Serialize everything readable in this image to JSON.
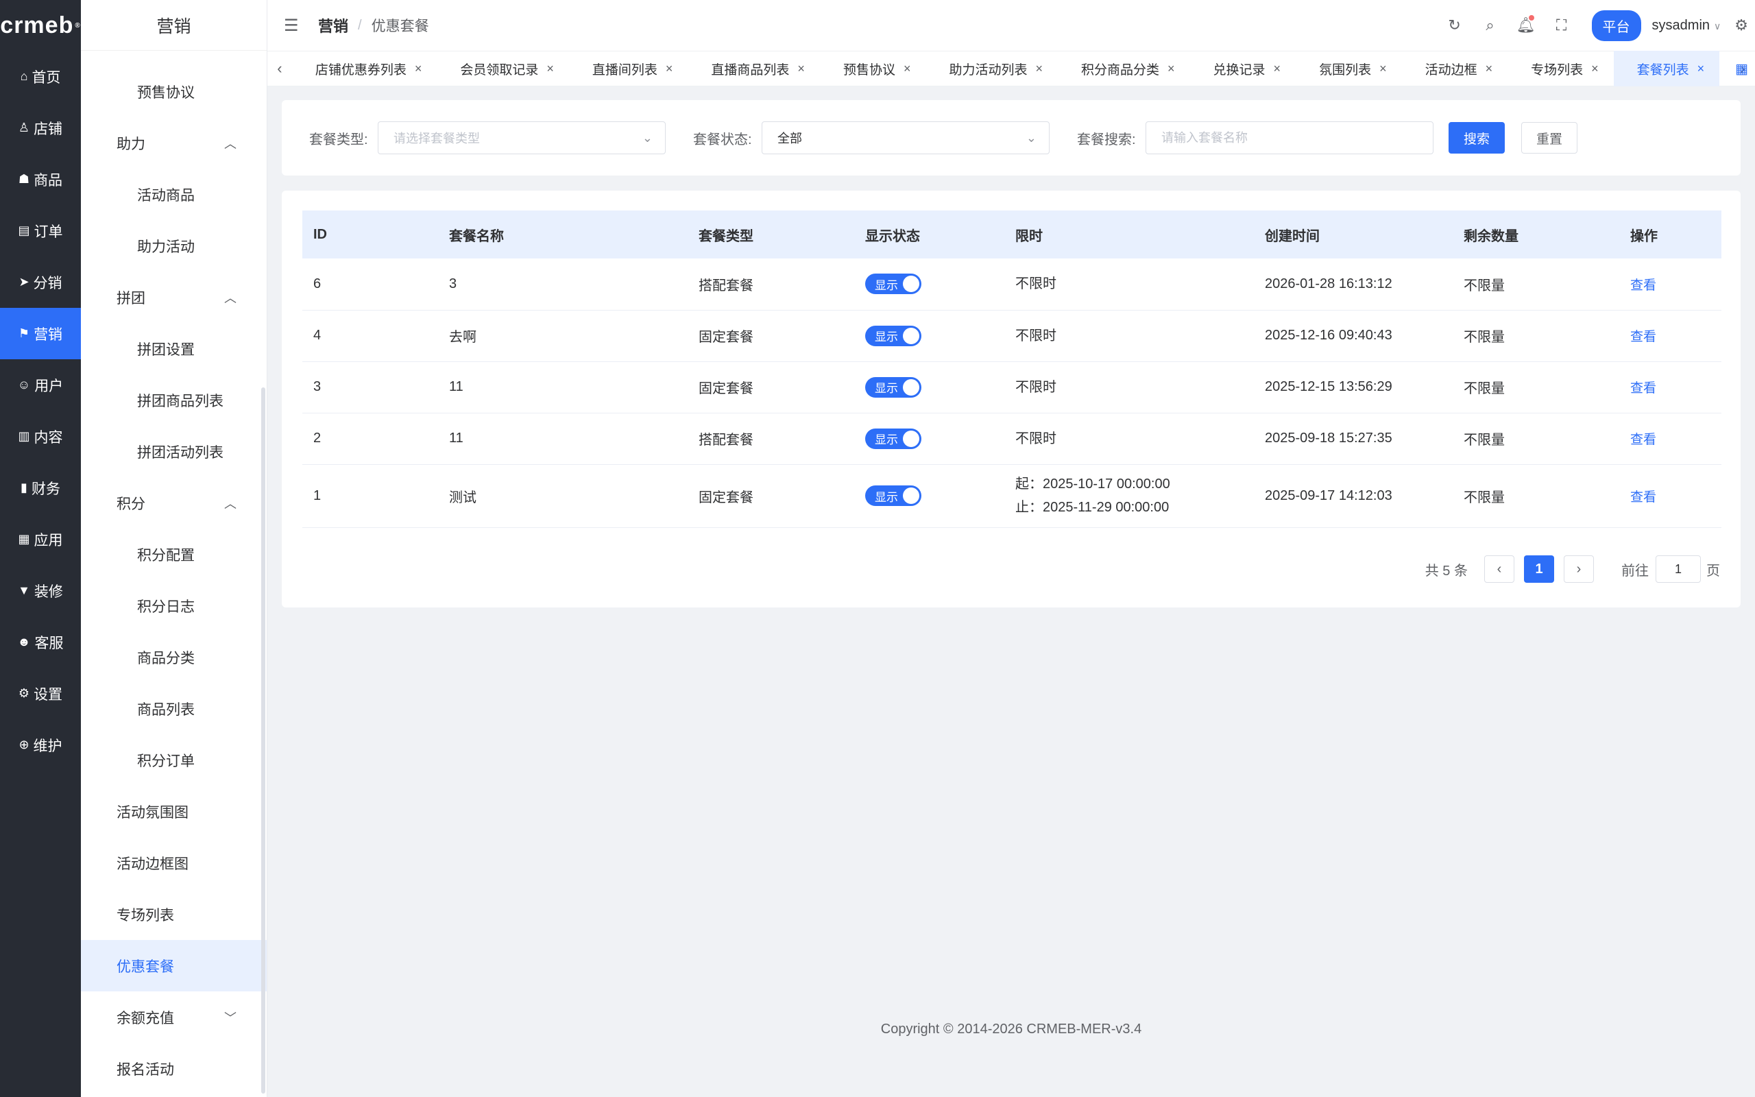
{
  "rail": {
    "logo": "crmeb",
    "logo_mark": "®",
    "items": [
      {
        "label": "首页",
        "icon": "home-icon",
        "glyph": "⌂",
        "active": false
      },
      {
        "label": "店铺",
        "icon": "store-icon",
        "glyph": "♙",
        "active": false
      },
      {
        "label": "商品",
        "icon": "bag-icon",
        "glyph": "☗",
        "active": false
      },
      {
        "label": "订单",
        "icon": "order-icon",
        "glyph": "▤",
        "active": false
      },
      {
        "label": "分销",
        "icon": "send-icon",
        "glyph": "➤",
        "active": false
      },
      {
        "label": "营销",
        "icon": "flag-icon",
        "glyph": "⚑",
        "active": true
      },
      {
        "label": "用户",
        "icon": "user-icon",
        "glyph": "☺",
        "active": false
      },
      {
        "label": "内容",
        "icon": "content-icon",
        "glyph": "▥",
        "active": false
      },
      {
        "label": "财务",
        "icon": "finance-icon",
        "glyph": "▮",
        "active": false
      },
      {
        "label": "应用",
        "icon": "apps-icon",
        "glyph": "▦",
        "active": false
      },
      {
        "label": "装修",
        "icon": "decor-icon",
        "glyph": "▼",
        "active": false
      },
      {
        "label": "客服",
        "icon": "service-icon",
        "glyph": "☻",
        "active": false
      },
      {
        "label": "设置",
        "icon": "gear-icon",
        "glyph": "⚙",
        "active": false
      },
      {
        "label": "维护",
        "icon": "maintain-icon",
        "glyph": "⊕",
        "active": false
      }
    ]
  },
  "sidebar": {
    "title": "营销",
    "items": [
      {
        "label": "预售协议",
        "level": 2
      },
      {
        "label": "助力",
        "level": 1,
        "chevron": "up"
      },
      {
        "label": "活动商品",
        "level": 2
      },
      {
        "label": "助力活动",
        "level": 2
      },
      {
        "label": "拼团",
        "level": 1,
        "chevron": "up"
      },
      {
        "label": "拼团设置",
        "level": 2
      },
      {
        "label": "拼团商品列表",
        "level": 2
      },
      {
        "label": "拼团活动列表",
        "level": 2
      },
      {
        "label": "积分",
        "level": 1,
        "chevron": "up"
      },
      {
        "label": "积分配置",
        "level": 2
      },
      {
        "label": "积分日志",
        "level": 2
      },
      {
        "label": "商品分类",
        "level": 2
      },
      {
        "label": "商品列表",
        "level": 2
      },
      {
        "label": "积分订单",
        "level": 2
      },
      {
        "label": "活动氛围图",
        "level": 1
      },
      {
        "label": "活动边框图",
        "level": 1
      },
      {
        "label": "专场列表",
        "level": 1
      },
      {
        "label": "优惠套餐",
        "level": 1,
        "active": true
      },
      {
        "label": "余额充值",
        "level": 1,
        "chevron": "down"
      },
      {
        "label": "报名活动",
        "level": 1
      }
    ]
  },
  "header": {
    "crumb_main": "营销",
    "crumb_sep": "/",
    "crumb_sub": "优惠套餐",
    "platform": "平台",
    "user": "sysadmin"
  },
  "tabs": [
    {
      "label": "店铺优惠券列表"
    },
    {
      "label": "会员领取记录"
    },
    {
      "label": "直播间列表"
    },
    {
      "label": "直播商品列表"
    },
    {
      "label": "预售协议"
    },
    {
      "label": "助力活动列表"
    },
    {
      "label": "积分商品分类"
    },
    {
      "label": "兑换记录"
    },
    {
      "label": "氛围列表"
    },
    {
      "label": "活动边框"
    },
    {
      "label": "专场列表"
    },
    {
      "label": "套餐列表",
      "active": true
    }
  ],
  "filters": {
    "type_label": "套餐类型:",
    "type_placeholder": "请选择套餐类型",
    "status_label": "套餐状态:",
    "status_value": "全部",
    "search_label": "套餐搜索:",
    "search_placeholder": "请输入套餐名称",
    "search_btn": "搜索",
    "reset_btn": "重置"
  },
  "table": {
    "headers": [
      "ID",
      "套餐名称",
      "套餐类型",
      "显示状态",
      "限时",
      "创建时间",
      "剩余数量",
      "操作"
    ],
    "rows": [
      {
        "id": "6",
        "name": "3",
        "type": "搭配套餐",
        "status": "显示",
        "limit1": "不限时",
        "limit2": "",
        "created": "2026-01-28 16:13:12",
        "remain": "不限量",
        "action": "查看"
      },
      {
        "id": "4",
        "name": "去啊",
        "type": "固定套餐",
        "status": "显示",
        "limit1": "不限时",
        "limit2": "",
        "created": "2025-12-16 09:40:43",
        "remain": "不限量",
        "action": "查看"
      },
      {
        "id": "3",
        "name": "11",
        "type": "固定套餐",
        "status": "显示",
        "limit1": "不限时",
        "limit2": "",
        "created": "2025-12-15 13:56:29",
        "remain": "不限量",
        "action": "查看"
      },
      {
        "id": "2",
        "name": "11",
        "type": "搭配套餐",
        "status": "显示",
        "limit1": "不限时",
        "limit2": "",
        "created": "2025-09-18 15:27:35",
        "remain": "不限量",
        "action": "查看"
      },
      {
        "id": "1",
        "name": "测试",
        "type": "固定套餐",
        "status": "显示",
        "limit1": "起：2025-10-17 00:00:00",
        "limit2": "止：2025-11-29 00:00:00",
        "created": "2025-09-17 14:12:03",
        "remain": "不限量",
        "action": "查看"
      }
    ]
  },
  "pagination": {
    "total": "共 5 条",
    "current": "1",
    "goto_label": "前往",
    "goto_value": "1",
    "page_suffix": "页"
  },
  "footer": "Copyright © 2014-2026 CRMEB-MER-v3.4"
}
